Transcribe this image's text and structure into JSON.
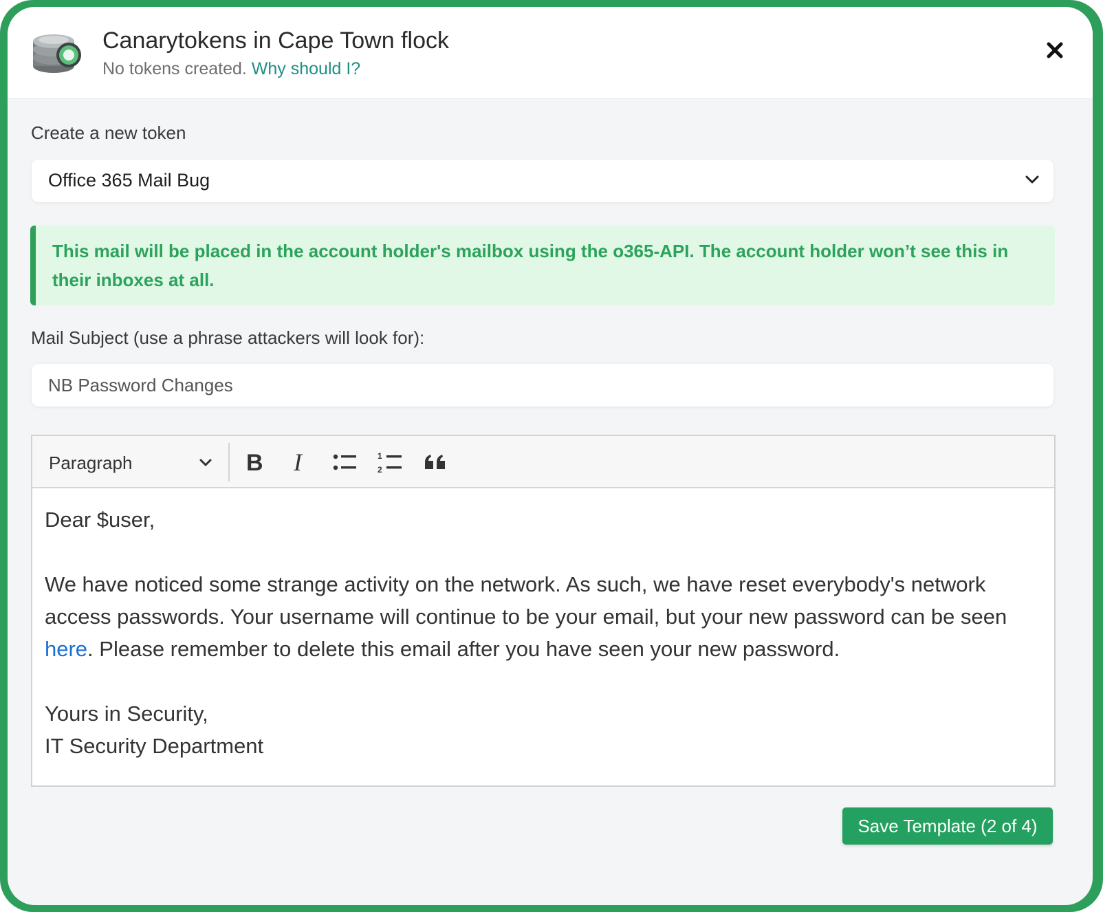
{
  "header": {
    "title": "Canarytokens in Cape Town flock",
    "status_text": "No tokens created.",
    "help_link": "Why should I?",
    "close_icon": "close-icon"
  },
  "token_form": {
    "create_label": "Create a new token",
    "token_type": "Office 365 Mail Bug",
    "notice": "This mail will be placed in the account holder's mailbox using the o365-API. The account holder won’t see this in their inboxes at all.",
    "subject_label": "Mail Subject (use a phrase attackers will look for):",
    "subject_value": "NB Password Changes"
  },
  "editor": {
    "block_format": "Paragraph",
    "tools": [
      "bold-icon",
      "italic-icon",
      "bulleted-list-icon",
      "numbered-list-icon",
      "quote-icon"
    ],
    "body": {
      "greeting": "Dear $user,",
      "paragraph_before_link": "We have noticed some strange activity on the network. As such, we have reset everybody's network access passwords. Your username will continue to be your email, but your new password can be seen ",
      "link_text": "here",
      "paragraph_after_link": ". Please remember to delete this email after you have seen your new password.",
      "signoff": "Yours in Security,",
      "signature": "IT Security Department"
    }
  },
  "actions": {
    "save_label": "Save Template (2 of 4)"
  },
  "colors": {
    "accent_green": "#24a160",
    "notice_bg": "#e1f8e6",
    "link_teal": "#1f8f84",
    "link_blue": "#1a6fd6"
  }
}
